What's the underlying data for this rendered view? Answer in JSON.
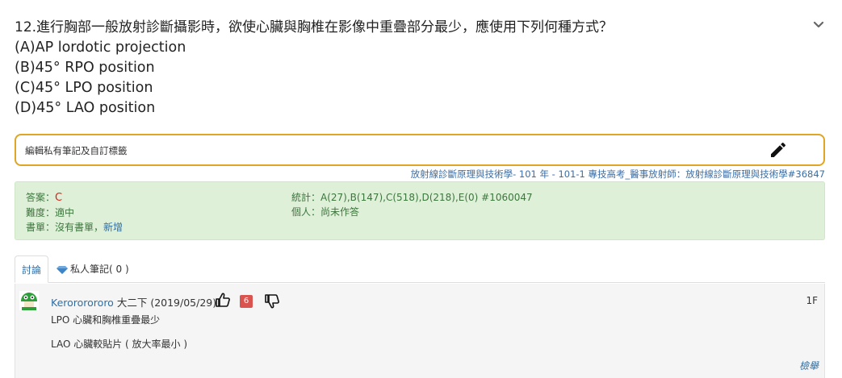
{
  "question": {
    "title": "12.進行胸部一般放射診斷攝影時，欲使心臟與胸椎在影像中重疊部分最少，應使用下列何種方式？",
    "options": [
      "(A)AP lordotic projection",
      "(B)45° RPO position",
      "(C)45° LPO position",
      "(D)45° LAO position"
    ],
    "collapse_icon": "chevron-down-icon"
  },
  "note": {
    "label": "編輯私有筆記及自訂標籤",
    "edit_icon": "pencil-icon"
  },
  "source": "放射線診斷原理與技術學- 101 年 - 101-1 專技高考_醫事放射師：放射線診斷原理與技術學#36847",
  "info": {
    "answer_label": "答案：",
    "answer_value": "C",
    "difficulty_label": "難度：",
    "difficulty_value": "適中",
    "booklist_label": "書單：",
    "booklist_value": "沒有書單，",
    "booklist_add": "新增",
    "stats_label": "統計：",
    "stats_value": "A(27),B(147),C(518),D(218),E(0) #1060047",
    "personal_label": "個人：",
    "personal_value": "尚未作答"
  },
  "tabs": {
    "discussion": "討論",
    "private_notes": "私人筆記( 0 )"
  },
  "comment": {
    "user": "Kerororororo",
    "grade": "大二下",
    "date": "(2019/05/29)",
    "likes": "6",
    "floor": "1F",
    "line1": "LPO 心臟和胸椎重疊最少",
    "line2": "LAO 心臟較貼片 ( 放大率最小 )",
    "report": "檢舉"
  },
  "colors": {
    "accent_border": "#e0a522",
    "info_bg": "#dff0d8",
    "info_text": "#3c763d",
    "answer_red": "#d9241c",
    "link_blue": "#2f6ea3",
    "badge_red": "#d9534f"
  }
}
